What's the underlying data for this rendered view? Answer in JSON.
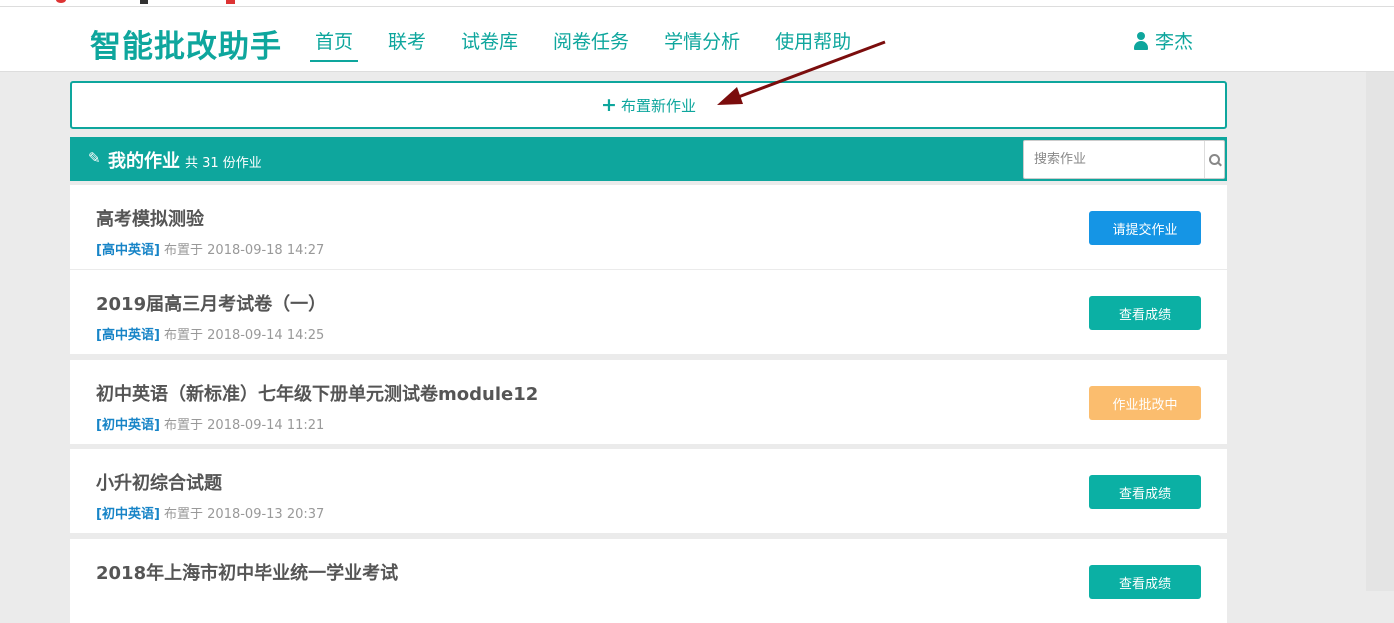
{
  "header": {
    "logo": "智能批改助手",
    "nav": [
      "首页",
      "联考",
      "试卷库",
      "阅卷任务",
      "学情分析",
      "使用帮助"
    ],
    "active_index": 0,
    "user_name": "李杰"
  },
  "assign": {
    "plus_glyph": "+",
    "label": "布置新作业"
  },
  "panel": {
    "title": "我的作业",
    "count_text": "共 31 份作业",
    "search_placeholder": "搜索作业"
  },
  "assignments": [
    {
      "title": "高考模拟测验",
      "tag": "[高中英语]",
      "meta": " 布置于 2018-09-18 14:27",
      "button": "请提交作业",
      "status": "submit"
    },
    {
      "title": "2019届高三月考试卷（一）",
      "tag": "[高中英语]",
      "meta": " 布置于 2018-09-14 14:25",
      "button": "查看成绩",
      "status": "graded"
    },
    {
      "title": "初中英语（新标准）七年级下册单元测试卷module12",
      "tag": "[初中英语]",
      "meta": " 布置于 2018-09-14 11:21",
      "button": "作业批改中",
      "status": "grading"
    },
    {
      "title": "小升初综合试题",
      "tag": "[初中英语]",
      "meta": " 布置于 2018-09-13 20:37",
      "button": "查看成绩",
      "status": "graded"
    },
    {
      "title": "2018年上海市初中毕业统一学业考试",
      "tag": "",
      "meta": "",
      "button": "查看成绩",
      "status": "graded"
    }
  ],
  "colors": {
    "brand": "#0ea69d",
    "submit": "#1595e5",
    "graded": "#0bb0a4",
    "grading": "#fbbd6e",
    "annotation_arrow": "#7b0d0d"
  },
  "icons": [
    "plus-icon",
    "pencil-icon",
    "search-icon",
    "user-icon"
  ]
}
